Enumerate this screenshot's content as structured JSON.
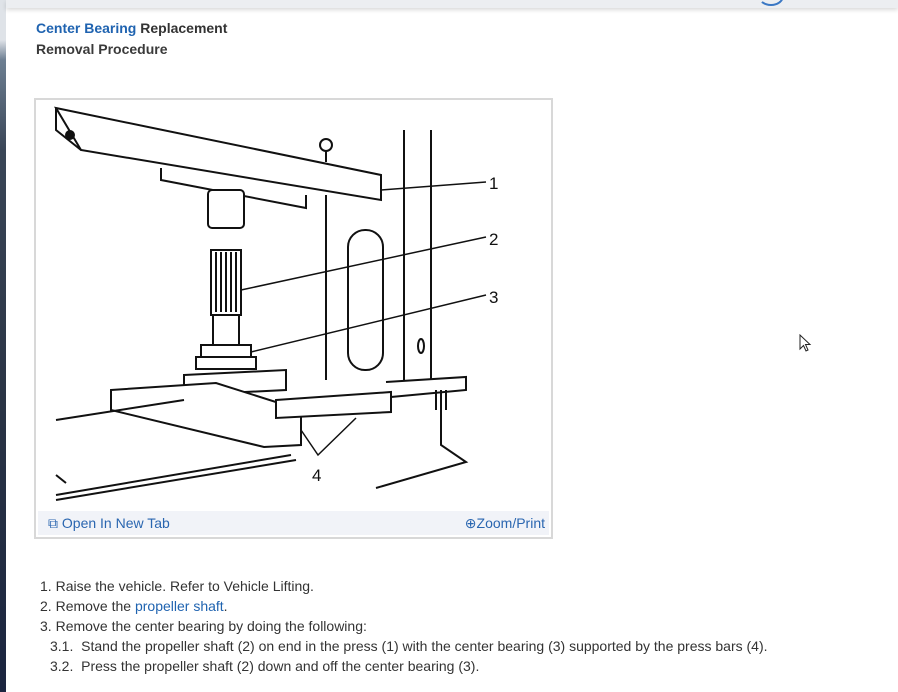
{
  "header": {
    "title_link": "Center Bearing",
    "title_rest": " Replacement",
    "subtitle": "Removal Procedure"
  },
  "figure": {
    "callouts": [
      "1",
      "2",
      "3",
      "4"
    ],
    "open_new_tab": "Open In New Tab",
    "zoom_print": "Zoom/Print",
    "accent_color": "#2a66b0"
  },
  "steps": [
    {
      "num": "1.",
      "text": "Raise the vehicle. Refer to Vehicle Lifting."
    },
    {
      "num": "2.",
      "pre": "Remove the ",
      "link": "propeller shaft",
      "post": "."
    },
    {
      "num": "3.",
      "text": "Remove the center bearing by doing the following:"
    },
    {
      "num": "3.1.",
      "text": "Stand the propeller shaft (2) on end in the press (1) with the center bearing (3) supported by the press bars (4)."
    },
    {
      "num": "3.2.",
      "text": "Press the propeller shaft (2) down and off the center bearing (3)."
    }
  ]
}
